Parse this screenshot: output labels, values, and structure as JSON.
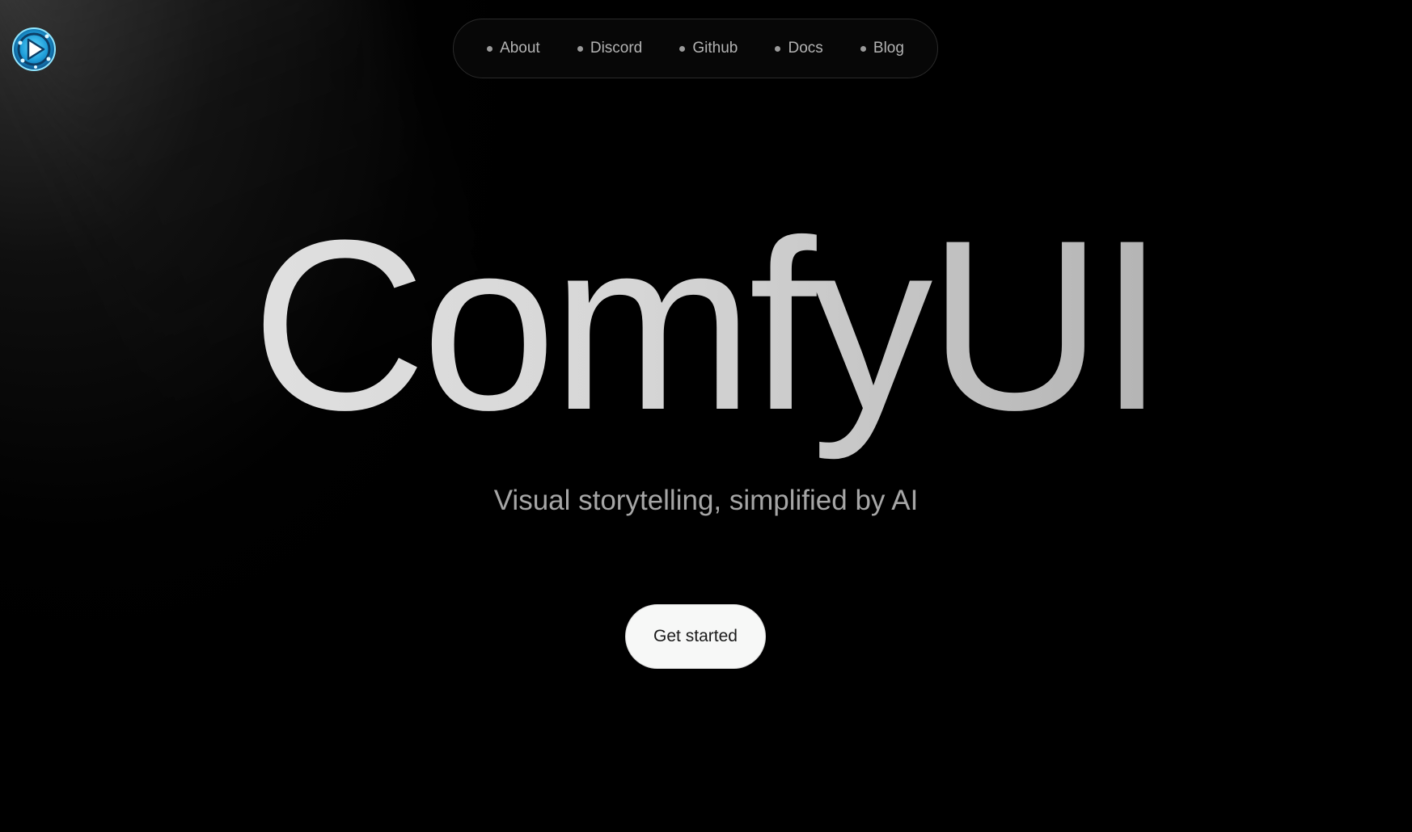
{
  "brand": {
    "logo_icon": "comfyui-logo-icon",
    "accent_color": "#2bb8e8"
  },
  "nav": {
    "items": [
      {
        "label": "About"
      },
      {
        "label": "Discord"
      },
      {
        "label": "Github"
      },
      {
        "label": "Docs"
      },
      {
        "label": "Blog"
      }
    ]
  },
  "hero": {
    "title": "ComfyUI",
    "subtitle": "Visual storytelling, simplified by AI",
    "cta_label": "Get started"
  },
  "colors": {
    "background": "#000000",
    "title_gradient_start": "#e6e6e6",
    "title_gradient_end": "#a3a3a3",
    "cta_background": "#f7f8f7"
  }
}
